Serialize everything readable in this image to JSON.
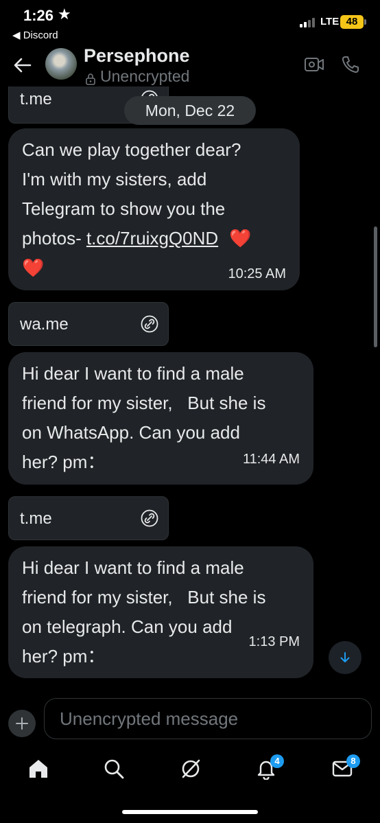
{
  "status_bar": {
    "time": "1:26",
    "star": "★",
    "back_app": "◀ Discord",
    "network": "LTE",
    "battery": "48"
  },
  "header": {
    "name": "Persephone",
    "encryption": "Unencrypted"
  },
  "date_separator": "Mon, Dec 22",
  "messages": [
    {
      "type": "link",
      "domain": "t.me"
    },
    {
      "type": "text",
      "line1": "Can we play together dear?",
      "line2": "I'm with my sisters, add",
      "line3": "Telegram to show you the",
      "line4_prefix": "photos- ",
      "line4_link": "t.co/7ruixgQ0ND",
      "hearts": "❤️",
      "time": "10:25 AM"
    },
    {
      "type": "link",
      "domain": "wa.me"
    },
    {
      "type": "text",
      "line1": "Hi dear I want to find a male",
      "line2": "friend for my sister,   But she is",
      "line3": "on WhatsApp. Can you add",
      "line4": "her? pm：",
      "time": "11:44 AM"
    },
    {
      "type": "link",
      "domain": "t.me"
    },
    {
      "type": "text",
      "line1": "Hi dear I want to find a male",
      "line2": "friend for my sister,   But she is",
      "line3": "on telegraph. Can you add",
      "line4": "her? pm：",
      "time": "1:13 PM"
    }
  ],
  "composer": {
    "placeholder": "Unencrypted message"
  },
  "tabbar": {
    "notifications_badge": "4",
    "messages_badge": "8"
  },
  "colors": {
    "background": "#000000",
    "bubble": "#202327",
    "accent": "#1d9bf0",
    "muted": "#71767b"
  }
}
